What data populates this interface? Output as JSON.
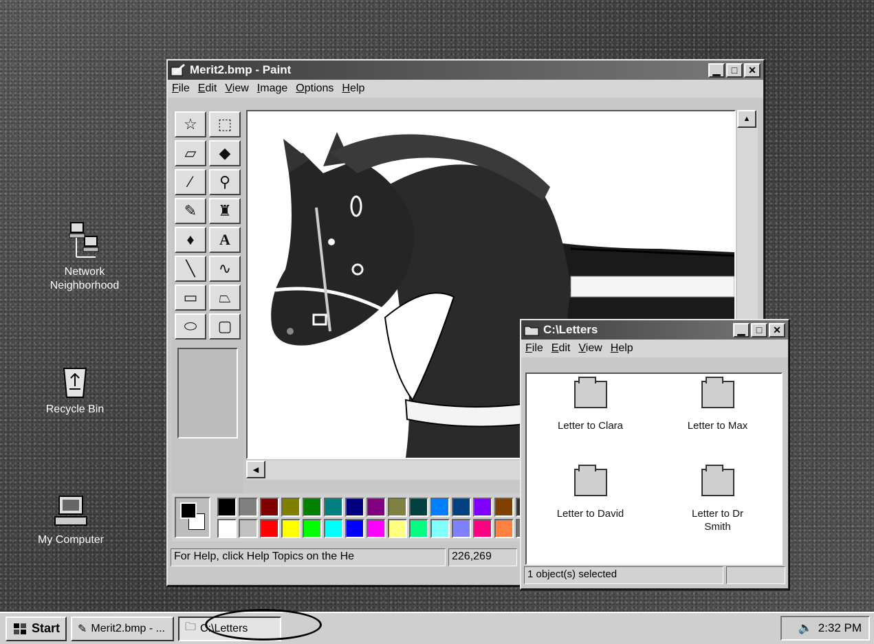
{
  "desktop": {
    "icons": [
      {
        "label": "Network Neighborhood"
      },
      {
        "label": "Recycle Bin"
      },
      {
        "label": "My Computer"
      }
    ]
  },
  "paint": {
    "title": "Merit2.bmp - Paint",
    "menu": [
      "File",
      "Edit",
      "View",
      "Image",
      "Options",
      "Help"
    ],
    "tools": [
      "free-select",
      "rect-select",
      "eraser",
      "fill",
      "color-picker",
      "magnifier",
      "pencil",
      "brush",
      "airbrush",
      "text",
      "line",
      "curve",
      "rectangle",
      "polygon",
      "ellipse",
      "rounded-rect"
    ],
    "status_help": "For Help, click Help Topics on the He",
    "status_coords": "226,269",
    "palette": [
      "#000000",
      "#808080",
      "#800000",
      "#808000",
      "#008000",
      "#008080",
      "#000080",
      "#800080",
      "#808040",
      "#004040",
      "#0080ff",
      "#004080",
      "#8000ff",
      "#804000",
      "#303030",
      "#ffffff",
      "#c0c0c0",
      "#ff0000",
      "#ffff00",
      "#00ff00",
      "#00ffff",
      "#0000ff",
      "#ff00ff",
      "#ffff80",
      "#00ff80",
      "#80ffff",
      "#8080ff",
      "#ff0080",
      "#ff8040",
      "#707070"
    ]
  },
  "letters": {
    "title": "C:\\Letters",
    "menu": [
      "File",
      "Edit",
      "View",
      "Help"
    ],
    "items": [
      {
        "label": "Letter to Clara"
      },
      {
        "label": "Letter to Max"
      },
      {
        "label": "Letter to David"
      },
      {
        "label": "Letter to Dr Smith"
      }
    ],
    "status": "1 object(s) selected"
  },
  "taskbar": {
    "start_label": "Start",
    "tasks": [
      {
        "label": "Merit2.bmp - ..."
      },
      {
        "label": "C:\\Letters"
      }
    ],
    "clock": "2:32 PM"
  }
}
